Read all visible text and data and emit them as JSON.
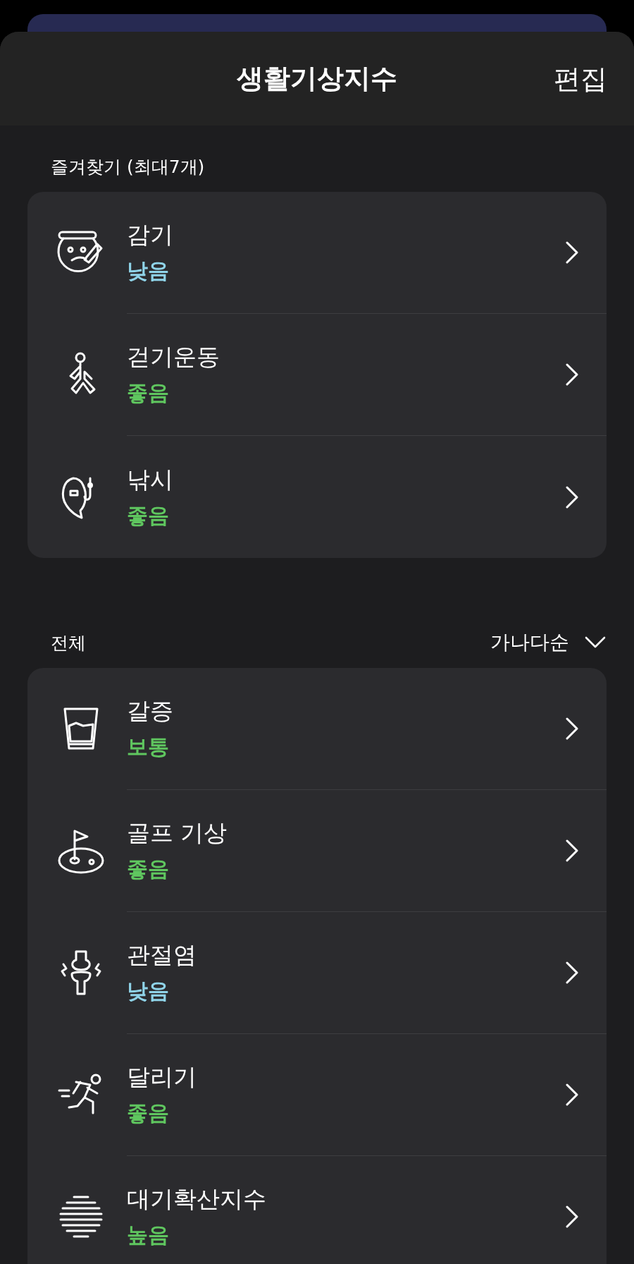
{
  "header": {
    "title": "생활기상지수",
    "edit_button": "편집"
  },
  "favorites": {
    "label": "즐겨찾기 (최대7개)",
    "items": [
      {
        "kind": "cold",
        "name": "감기",
        "status": "낮음",
        "color": "#8fd3e8"
      },
      {
        "kind": "walk",
        "name": "걷기운동",
        "status": "좋음",
        "color": "#5fc65f"
      },
      {
        "kind": "fishing",
        "name": "낚시",
        "status": "좋음",
        "color": "#5fc65f"
      }
    ]
  },
  "all": {
    "label": "전체",
    "sort": "가나다순",
    "items": [
      {
        "kind": "thirst",
        "name": "갈증",
        "status": "보통",
        "color": "#5fc65f"
      },
      {
        "kind": "golf",
        "name": "골프 기상",
        "status": "좋음",
        "color": "#5fc65f"
      },
      {
        "kind": "joint",
        "name": "관절염",
        "status": "낮음",
        "color": "#8fd3e8"
      },
      {
        "kind": "running",
        "name": "달리기",
        "status": "좋음",
        "color": "#5fc65f"
      },
      {
        "kind": "haze",
        "name": "대기확산지수",
        "status": "높음",
        "color": "#5fc65f"
      }
    ]
  }
}
